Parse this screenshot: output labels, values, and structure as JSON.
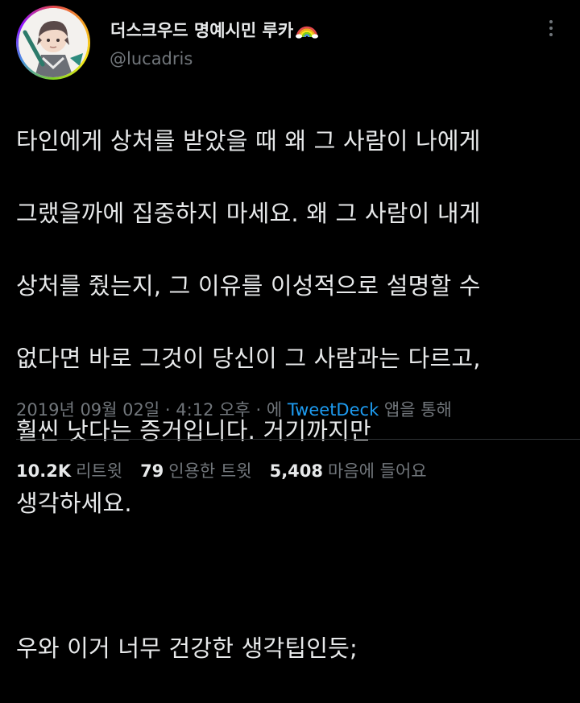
{
  "tweet": {
    "display_name": "더스크우드 명예시민 루카",
    "name_emoji_icon": "rainbow-icon",
    "handle": "@lucadris",
    "body_lines": [
      "타인에게 상처를 받았을 때 왜 그 사람이 나에게",
      "그랬을까에 집중하지 마세요. 왜 그 사람이 내게",
      "상처를 줬는지, 그 이유를 이성적으로 설명할 수",
      "없다면 바로 그것이 당신이 그 사람과는 다르고,",
      "훨씬 낫다는 증거입니다. 거기까지만",
      "생각하세요.",
      "",
      "우와 이거 너무 건강한 생각팁인듯;"
    ],
    "date": "2019년 09월 02일",
    "time": "4:12 오후",
    "via_prefix": "에",
    "source": "TweetDeck",
    "via_suffix": "앱을 통해",
    "separator": "·"
  },
  "stats": {
    "retweets_count": "10.2K",
    "retweets_label": "리트윗",
    "quotes_count": "79",
    "quotes_label": "인용한 트윗",
    "likes_count": "5,408",
    "likes_label": "마음에 들어요"
  },
  "colors": {
    "background": "#000000",
    "text_primary": "#e7e9ea",
    "text_secondary": "#71767b",
    "link": "#1d9bf0",
    "divider": "#2f3336"
  }
}
